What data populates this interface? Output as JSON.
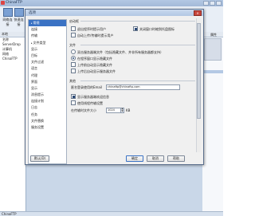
{
  "app": {
    "title": "ChinaFTP"
  },
  "toolbar": {
    "items": [
      "网络连接",
      "快速连接"
    ]
  },
  "left_panel": {
    "header": "本地",
    "items": [
      "名称",
      "ServerDrop",
      "计算机",
      "网络",
      "ChinaFTP"
    ]
  },
  "right_panel": {
    "header": "属性"
  },
  "status_bar": {
    "text": "ChinaFTP"
  },
  "dialog": {
    "title": "选项",
    "close_label": "×",
    "nav": {
      "items": [
        {
          "label": "常规",
          "selected": true
        },
        {
          "label": "连接",
          "selected": false
        },
        {
          "label": "传输",
          "selected": false
        },
        {
          "label": "文件类型",
          "selected": false
        },
        {
          "label": "显示",
          "selected": false
        },
        {
          "label": "目标",
          "selected": false
        },
        {
          "label": "文件过滤",
          "selected": false
        },
        {
          "label": "语言",
          "selected": false
        },
        {
          "label": "代理",
          "selected": false
        },
        {
          "label": "界面",
          "selected": false
        },
        {
          "label": "显示",
          "selected": false
        },
        {
          "label": "消息提示",
          "selected": false
        },
        {
          "label": "连接计划",
          "selected": false
        },
        {
          "label": "日志",
          "selected": false
        },
        {
          "label": "任务",
          "selected": false
        },
        {
          "label": "文件替换",
          "selected": false
        },
        {
          "label": "服务设置",
          "selected": false
        }
      ]
    },
    "sections": {
      "startup": {
        "title": "启动框",
        "options": [
          {
            "label": "退出程序时提示用户",
            "checked": false
          },
          {
            "label": "关闭窗口时缩到托盘图标",
            "checked": true
          },
          {
            "label": "自动上传/传输时提示用户",
            "checked": false
          }
        ]
      },
      "files": {
        "title": "文件",
        "options": [
          {
            "label": "双击服务器端文件（包括隐藏文件、并非所有服务器都支持）",
            "checked": false
          },
          {
            "label": "在程序窗口显示隐藏文件",
            "checked": true
          },
          {
            "label": "上传前自动显示隐藏文件",
            "checked": false
          },
          {
            "label": "上传后自动显示服务器文件",
            "checked": false
          }
        ]
      },
      "other": {
        "title": "其他",
        "email_label": "匿名登录使用的Email",
        "email_value": "chinaftp@chinaftp.com",
        "options": [
          {
            "label": "显示服务器端欢迎信息",
            "checked": true
          },
          {
            "label": "使用线程传输设置",
            "checked": false
          }
        ],
        "limit_label": "在传输时文件大小",
        "limit_value": "1024",
        "limit_unit": "KB"
      }
    },
    "buttons": {
      "defaults": "默认(D)",
      "ok": "确定",
      "cancel": "取消",
      "help": "帮助"
    }
  }
}
